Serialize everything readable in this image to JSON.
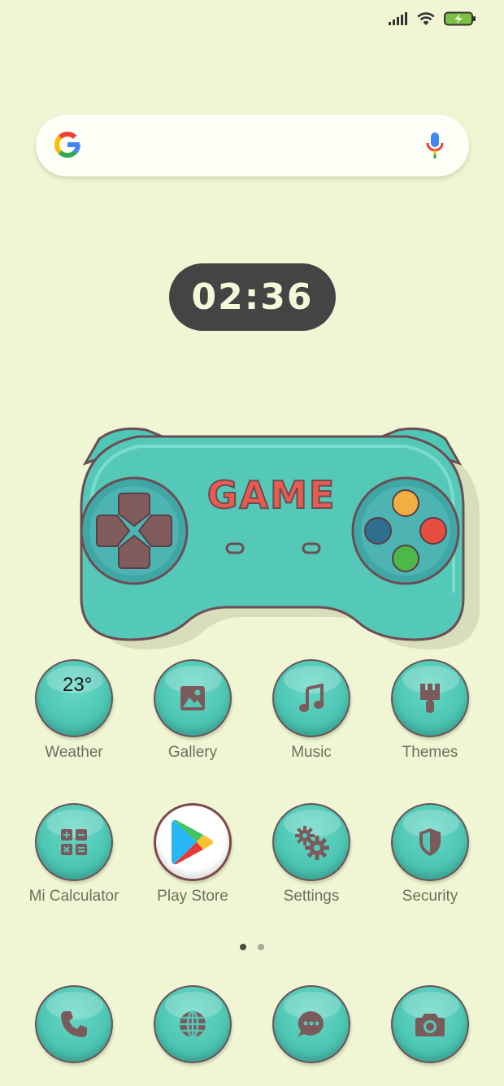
{
  "status_bar": {
    "icons": [
      "signal-icon",
      "wifi-icon",
      "battery-charging-icon"
    ],
    "battery_color": "#7bc142"
  },
  "search_bar": {
    "logo": "google-logo",
    "mic": "microphone-icon"
  },
  "clock": {
    "time": "02:36"
  },
  "game_widget": {
    "title": "GAME"
  },
  "apps_row1": [
    {
      "label": "Weather",
      "icon": "weather-icon",
      "temperature": "23°"
    },
    {
      "label": "Gallery",
      "icon": "gallery-icon"
    },
    {
      "label": "Music",
      "icon": "music-note-icon"
    },
    {
      "label": "Themes",
      "icon": "paint-brush-icon"
    }
  ],
  "apps_row2": [
    {
      "label": "Mi Calculator",
      "icon": "calculator-icon"
    },
    {
      "label": "Play Store",
      "icon": "play-store-icon"
    },
    {
      "label": "Settings",
      "icon": "gears-icon"
    },
    {
      "label": "Security",
      "icon": "shield-icon"
    }
  ],
  "page_indicator": {
    "total": 2,
    "current": 1
  },
  "dock": [
    {
      "icon": "phone-icon"
    },
    {
      "icon": "browser-globe-icon"
    },
    {
      "icon": "messages-icon"
    },
    {
      "icon": "camera-icon"
    }
  ],
  "colors": {
    "background": "#f0f6d4",
    "icon_teal": "#4ec7b4",
    "glyph": "#7b5a5c",
    "label": "#6f6e5e"
  }
}
